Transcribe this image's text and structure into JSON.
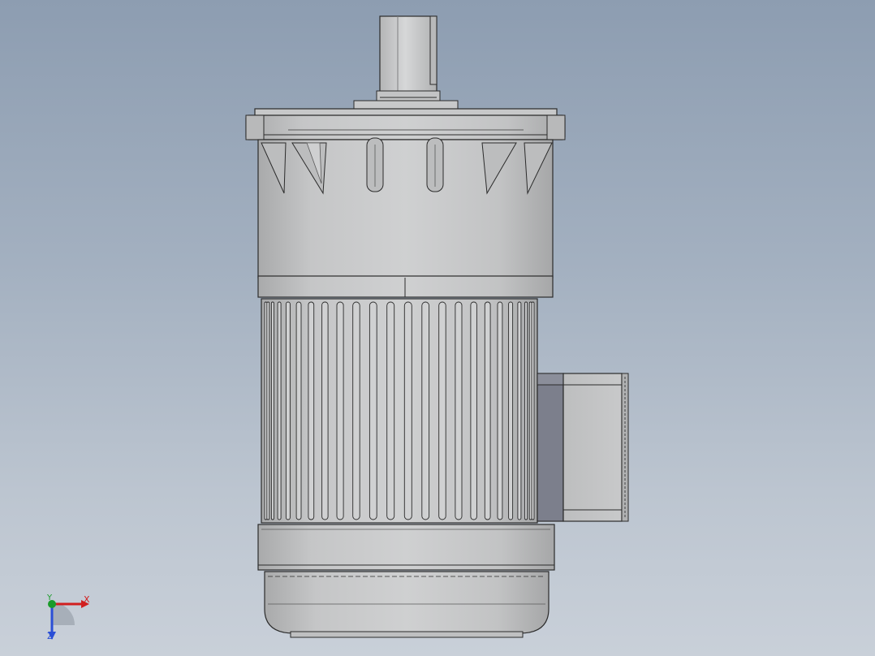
{
  "viewport": {
    "background_top": "#8d9db1",
    "background_bottom": "#c9d0d9"
  },
  "model": {
    "body_color": "#c4c5c6",
    "line_color": "#2b2b2b",
    "terminal_box_side_color": "#7c7f8c"
  },
  "triad": {
    "x_label": "X",
    "y_label": "Y",
    "z_label": "Z",
    "x_color": "#d11f1f",
    "y_color": "#1a9b2a",
    "z_color": "#2b4fd6"
  }
}
